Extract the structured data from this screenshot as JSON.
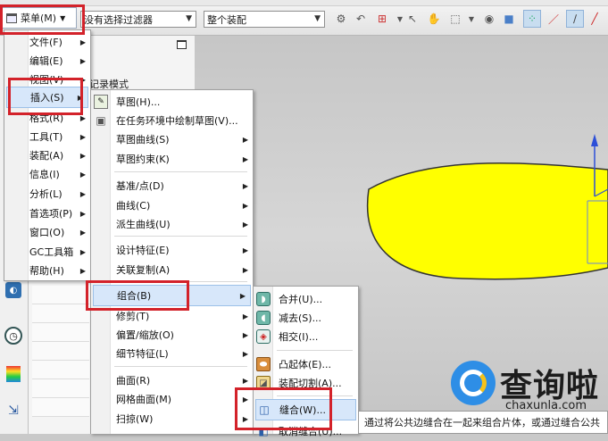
{
  "toolbar": {
    "menu_label": "菜单(M)",
    "filter_value": "没有选择过滤器",
    "scope_value": "整个装配"
  },
  "nav": {
    "partial_text": "记录模式"
  },
  "main_menu": {
    "items": [
      {
        "label": "文件(F)"
      },
      {
        "label": "编辑(E)"
      },
      {
        "label": "视图(V)"
      },
      {
        "label": "插入(S)"
      },
      {
        "label": "格式(R)"
      },
      {
        "label": "工具(T)"
      },
      {
        "label": "装配(A)"
      },
      {
        "label": "信息(I)"
      },
      {
        "label": "分析(L)"
      },
      {
        "label": "首选项(P)"
      },
      {
        "label": "窗口(O)"
      },
      {
        "label": "GC工具箱"
      },
      {
        "label": "帮助(H)"
      }
    ]
  },
  "insert_menu": {
    "items": [
      {
        "label": "草图(H)..."
      },
      {
        "label": "在任务环境中绘制草图(V)..."
      },
      {
        "label": "草图曲线(S)"
      },
      {
        "label": "草图约束(K)"
      },
      {
        "label": "基准/点(D)"
      },
      {
        "label": "曲线(C)"
      },
      {
        "label": "派生曲线(U)"
      },
      {
        "label": "设计特征(E)"
      },
      {
        "label": "关联复制(A)"
      },
      {
        "label": "组合(B)"
      },
      {
        "label": "修剪(T)"
      },
      {
        "label": "偏置/缩放(O)"
      },
      {
        "label": "细节特征(L)"
      },
      {
        "label": "曲面(R)"
      },
      {
        "label": "网格曲面(M)"
      },
      {
        "label": "扫掠(W)"
      }
    ]
  },
  "combine_menu": {
    "items": [
      {
        "label": "合并(U)..."
      },
      {
        "label": "减去(S)..."
      },
      {
        "label": "相交(I)..."
      },
      {
        "label": "凸起体(E)..."
      },
      {
        "label": "装配切割(A)..."
      },
      {
        "label": "缝合(W)..."
      },
      {
        "label": "取消缝合(U)..."
      }
    ]
  },
  "tooltip": {
    "text": "通过将公共边缝合在一起来组合片体，或通过缝合公共"
  },
  "watermark": {
    "brand": "查询啦",
    "url": "chaxunla.com"
  },
  "colors": {
    "highlight_border": "#d3222a",
    "shape_fill": "#ffff00",
    "menu_hover": "#d7e7fa"
  }
}
